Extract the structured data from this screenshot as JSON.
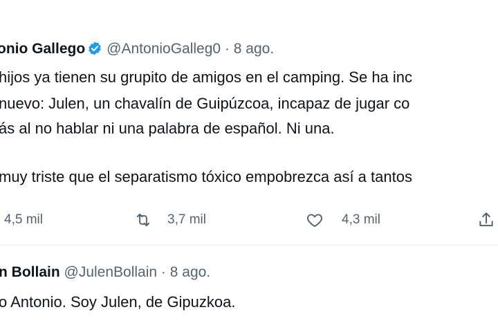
{
  "tweet1": {
    "name": "onio Gallego",
    "handle": "@AntonioGalleg0",
    "separator": " · ",
    "date": "8 ago.",
    "lines": [
      "hijos ya tienen su grupito de amigos en el camping. Se ha inc",
      "nuevo: Julen, un chavalín de Guipúzcoa, incapaz de jugar co",
      "ás al no hablar ni una palabra de español. Ni una.",
      "muy triste que el separatismo tóxico empobrezca así a tantos"
    ],
    "actions": {
      "replies": "4,5 mil",
      "retweets": "3,7 mil",
      "likes": "4,3 mil"
    }
  },
  "tweet2": {
    "name": "n Bollain",
    "handle": "@JulenBollain",
    "separator": " · ",
    "date": "8 ago.",
    "lines": [
      "o Antonio. Soy Julen, de Gipuzkoa."
    ]
  },
  "icons": {
    "verified": "verified-badge-icon",
    "retweet": "retweet-icon",
    "like": "heart-icon",
    "share": "share-icon"
  },
  "colors": {
    "text": "#0f1419",
    "secondary": "#536471",
    "verified": "#1d9bf0"
  }
}
